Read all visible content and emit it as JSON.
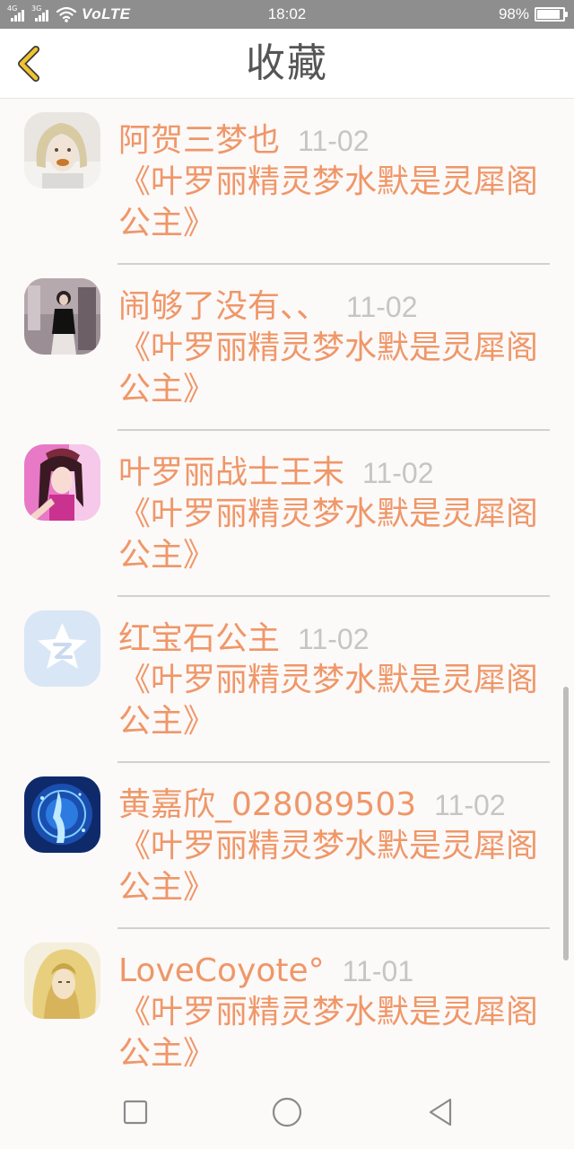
{
  "status_bar": {
    "network_1": "4G",
    "network_2": "3G",
    "volte": "VoLTE",
    "time": "18:02",
    "battery_text": "98%",
    "battery_level": 0.98,
    "icons": [
      "signal-icon",
      "signal-icon",
      "wifi-icon",
      "battery-icon"
    ]
  },
  "title_bar": {
    "back_icon": "chevron-left-icon",
    "title": "收藏"
  },
  "favorites": [
    {
      "username": "阿贺三梦也",
      "date": "11-02",
      "title": "《叶罗丽精灵梦水默是灵犀阁公主》",
      "avatar": "avatar-photo"
    },
    {
      "username": "闹够了没有、、",
      "date": "11-02",
      "title": "《叶罗丽精灵梦水默是灵犀阁公主》",
      "avatar": "avatar-photo"
    },
    {
      "username": "叶罗丽战士王末",
      "date": "11-02",
      "title": "《叶罗丽精灵梦水默是灵犀阁公主》",
      "avatar": "avatar-photo"
    },
    {
      "username": "红宝石公主",
      "date": "11-02",
      "title": "《叶罗丽精灵梦水默是灵犀阁公主》",
      "avatar": "qzone-star-icon"
    },
    {
      "username": "黄嘉欣_028089503",
      "date": "11-02",
      "title": "《叶罗丽精灵梦水默是灵犀阁公主》",
      "avatar": "avatar-photo"
    },
    {
      "username": "LoveCoyote°",
      "date": "11-01",
      "title": "《叶罗丽精灵梦水默是灵犀阁公主》",
      "avatar": "avatar-photo"
    }
  ],
  "nav_bar": {
    "icons": [
      "square-recent-apps-icon",
      "circle-home-icon",
      "triangle-back-icon"
    ]
  },
  "colors": {
    "accent": "#ef9768",
    "date": "#c5c5c5",
    "back_chevron": "#f2c230",
    "status_bar_bg": "#8e8e8e"
  }
}
